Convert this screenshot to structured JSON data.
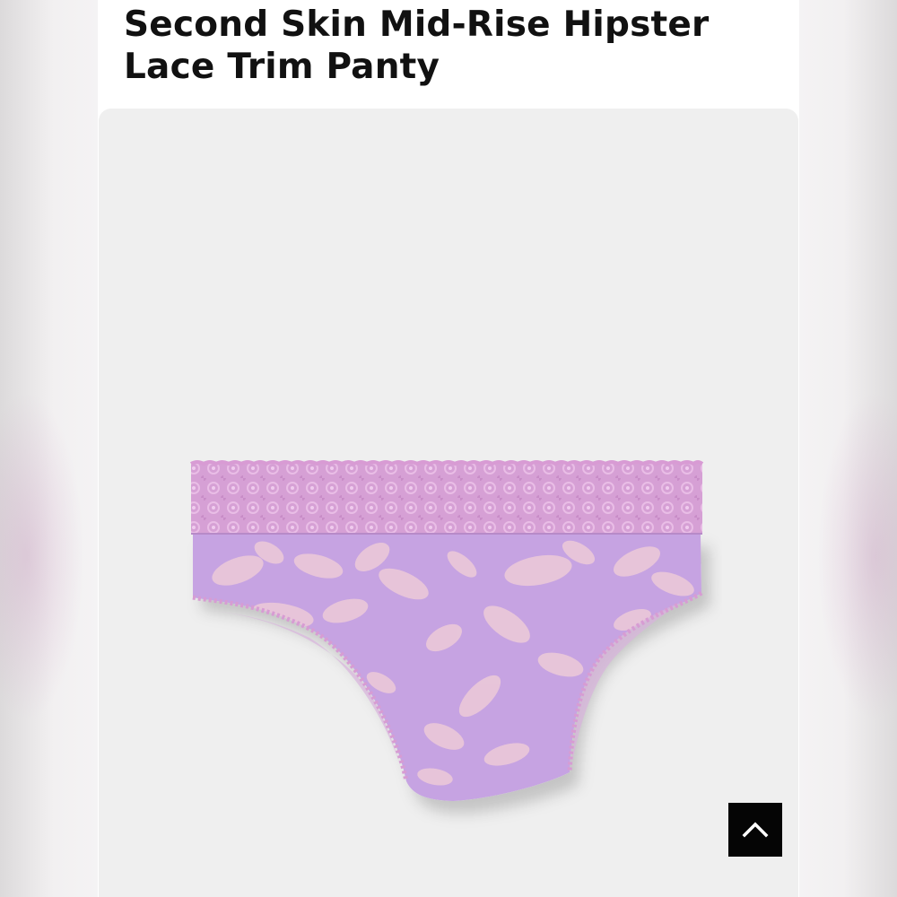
{
  "product": {
    "title": "Second Skin Mid-Rise Hipster Lace Trim Panty",
    "image_description_icon": "product-photo",
    "colors": {
      "fabric": "#c7a5e3",
      "lace": "#d9a3d7",
      "print": "#e8c6d8",
      "background": "#efefef"
    }
  },
  "controls": {
    "scroll_top_icon": "chevron-up-icon"
  }
}
